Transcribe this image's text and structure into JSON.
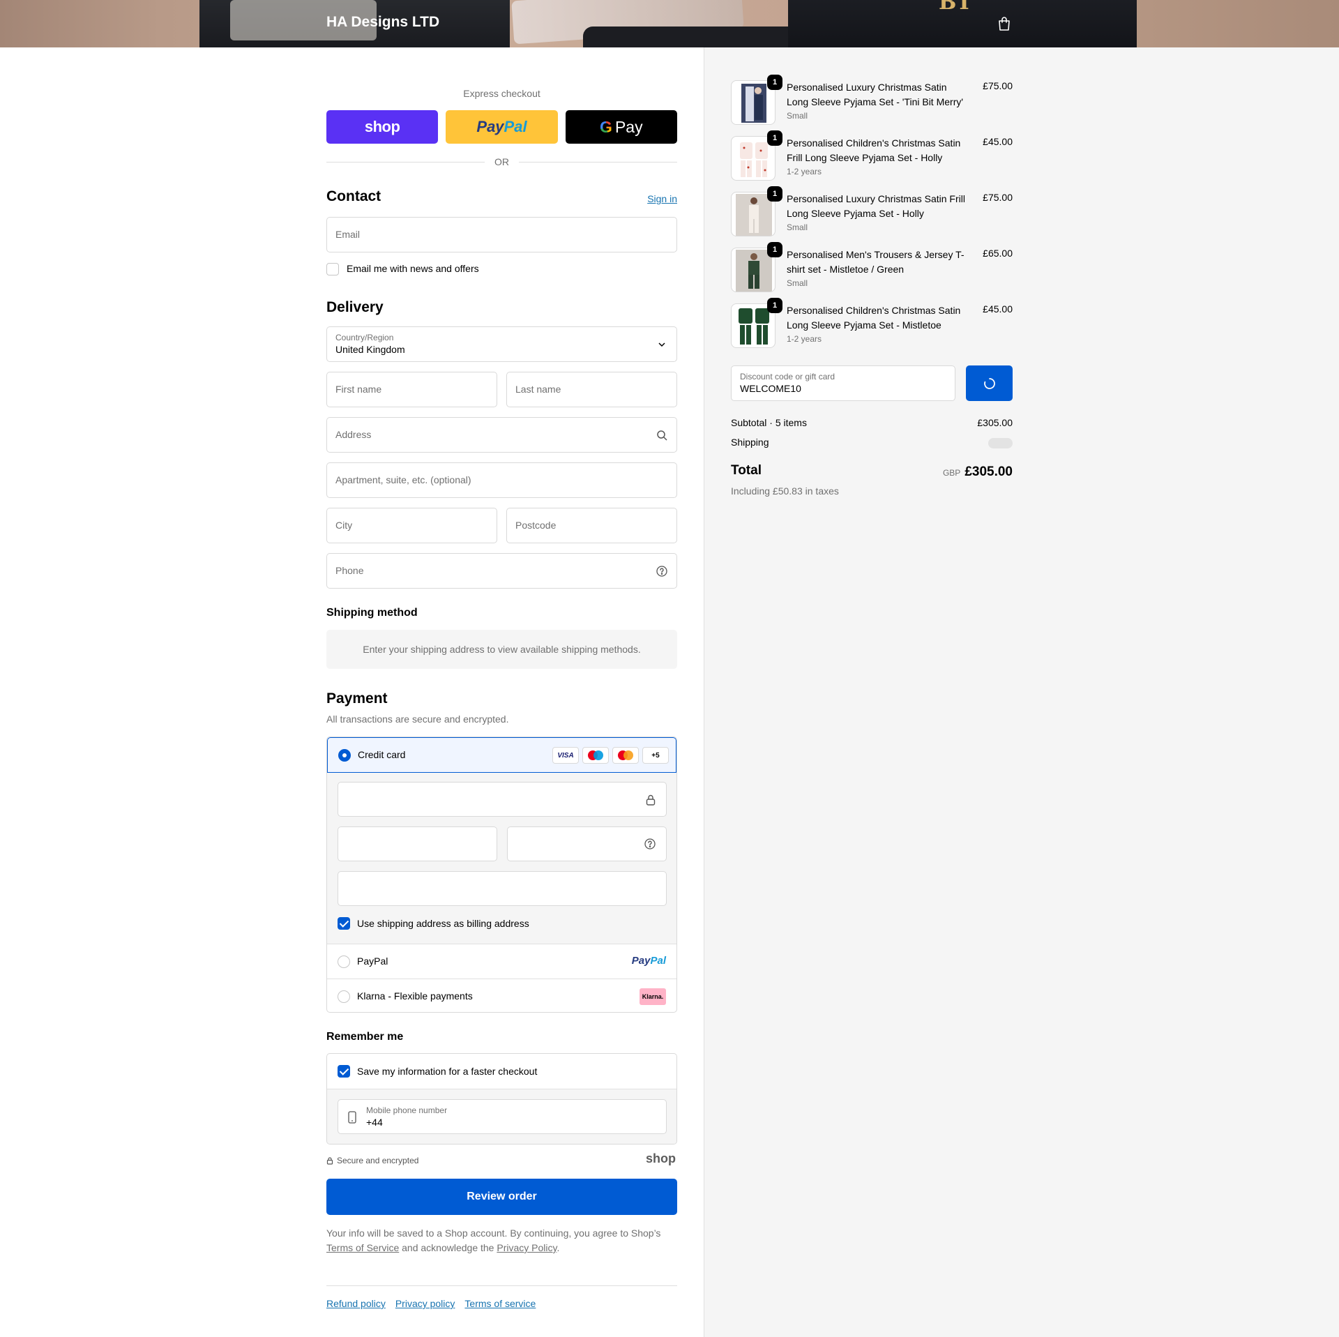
{
  "header": {
    "store_name": "HA Designs LTD",
    "cart_icon": "shopping-bag-icon"
  },
  "express": {
    "title": "Express checkout",
    "shop_label": "shop",
    "paypal_label_a": "Pay",
    "paypal_label_b": "Pal",
    "gpay_g": "G",
    "gpay_label": "Pay",
    "or_label": "OR"
  },
  "contact": {
    "heading": "Contact",
    "signin_label": "Sign in",
    "email_placeholder": "Email",
    "news_label": "Email me with news and offers"
  },
  "delivery": {
    "heading": "Delivery",
    "country_label": "Country/Region",
    "country_value": "United Kingdom",
    "first_name": "First name",
    "last_name": "Last name",
    "address": "Address",
    "apartment": "Apartment, suite, etc. (optional)",
    "city": "City",
    "postcode": "Postcode",
    "phone": "Phone"
  },
  "shipping_method": {
    "heading": "Shipping method",
    "info": "Enter your shipping address to view available shipping methods."
  },
  "payment": {
    "heading": "Payment",
    "subtitle": "All transactions are secure and encrypted.",
    "credit_card_label": "Credit card",
    "card_logos": [
      "VISA",
      "+5"
    ],
    "billing_label": "Use shipping address as billing address",
    "paypal_label": "PayPal",
    "paypal_logo_a": "Pay",
    "paypal_logo_b": "Pal",
    "klarna_label": "Klarna - Flexible payments",
    "klarna_logo": "Klarna."
  },
  "remember": {
    "heading": "Remember me",
    "save_label": "Save my information for a faster checkout",
    "mobile_label": "Mobile phone number",
    "mobile_value": "+44",
    "secure_label": "Secure and encrypted",
    "shop_logo": "shop"
  },
  "review_button": "Review order",
  "legal": {
    "text_a": "Your info will be saved to a Shop account. By continuing, you agree to Shop’s ",
    "terms": "Terms of Service",
    "text_b": " and acknowledge the ",
    "privacy": "Privacy Policy",
    "text_c": "."
  },
  "footer": {
    "refund": "Refund policy",
    "privacy": "Privacy policy",
    "terms": "Terms of service"
  },
  "summary": {
    "items": [
      {
        "name": "Personalised Luxury Christmas Satin Long Sleeve Pyjama Set - 'Tini Bit Merry'",
        "variant": "Small",
        "price": "£75.00",
        "qty": "1"
      },
      {
        "name": "Personalised Children's Christmas Satin Frill Long Sleeve Pyjama Set - Holly",
        "variant": "1-2 years",
        "price": "£45.00",
        "qty": "1"
      },
      {
        "name": "Personalised Luxury Christmas Satin Frill Long Sleeve Pyjama Set - Holly",
        "variant": "Small",
        "price": "£75.00",
        "qty": "1"
      },
      {
        "name": "Personalised Men's Trousers & Jersey T-shirt set - Mistletoe / Green",
        "variant": "Small",
        "price": "£65.00",
        "qty": "1"
      },
      {
        "name": "Personalised Children's Christmas Satin Long Sleeve Pyjama Set - Mistletoe",
        "variant": "1-2 years",
        "price": "£45.00",
        "qty": "1"
      }
    ],
    "discount_label": "Discount code or gift card",
    "discount_value": "WELCOME10",
    "subtotal_label": "Subtotal · 5 items",
    "subtotal_value": "£305.00",
    "shipping_label": "Shipping",
    "total_label": "Total",
    "currency": "GBP",
    "total_value": "£305.00",
    "taxes": "Including £50.83 in taxes"
  }
}
